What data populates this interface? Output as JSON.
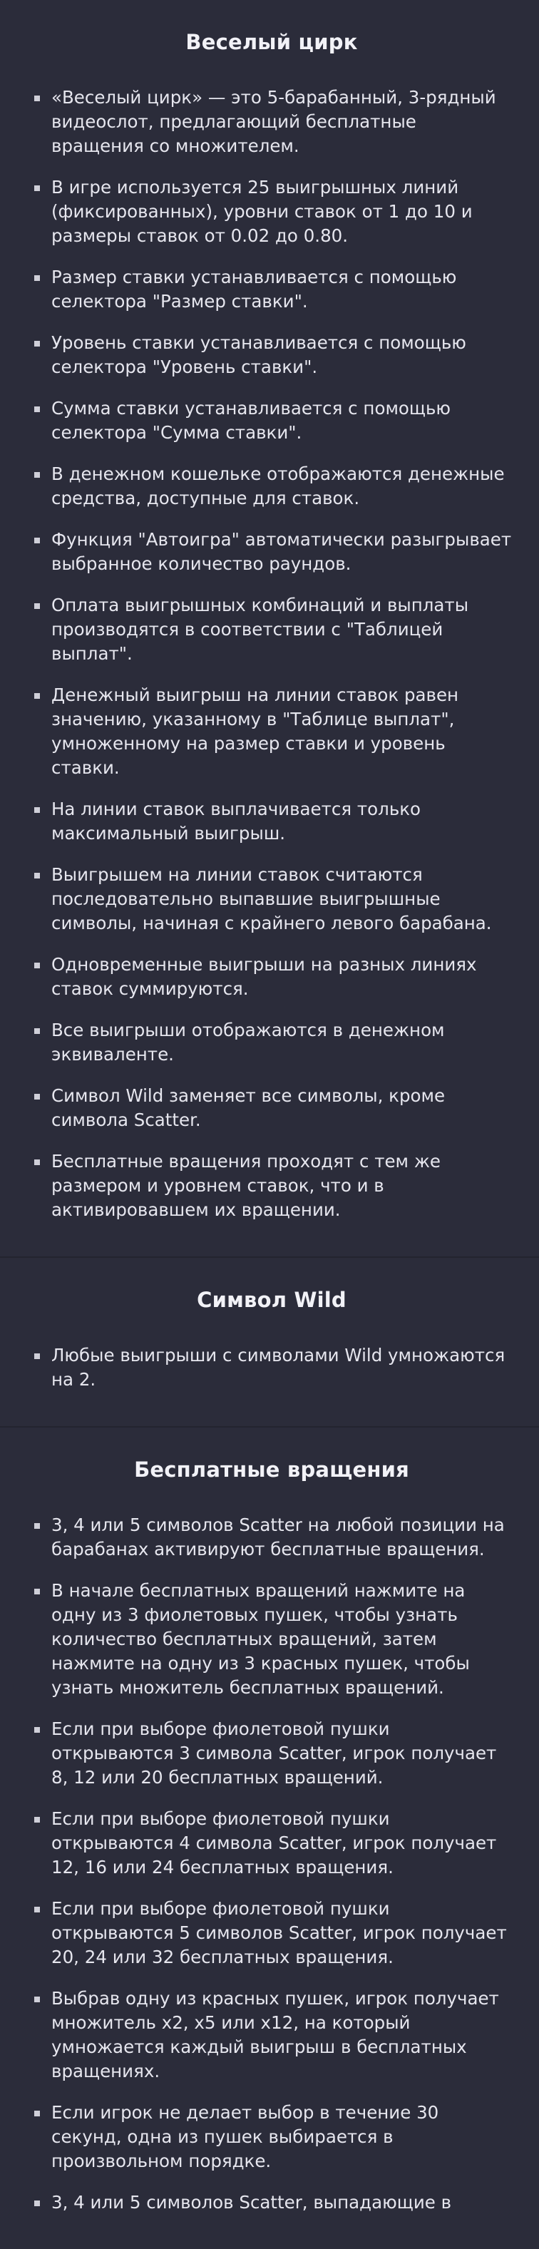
{
  "sections": [
    {
      "title": "Веселый цирк",
      "items": [
        "«Веселый цирк» — это 5-барабанный, 3-рядный видеослот, предлагающий бесплатные вращения со множителем.",
        "В игре используется 25 выигрышных линий (фиксированных), уровни ставок от 1 до 10 и размеры ставок от 0.02 до 0.80.",
        "Размер ставки устанавливается с помощью селектора \"Размер ставки\".",
        "Уровень ставки устанавливается с помощью селектора \"Уровень ставки\".",
        "Сумма ставки устанавливается с помощью селектора \"Сумма ставки\".",
        "В денежном кошельке отображаются денежные средства, доступные для ставок.",
        "Функция \"Автоигра\" автоматически разыгрывает выбранное количество раундов.",
        "Оплата выигрышных комбинаций и выплаты производятся в соответствии с \"Таблицей выплат\".",
        "Денежный выигрыш на линии ставок равен значению, указанному в \"Таблице выплат\", умноженному на размер ставки и уровень ставки.",
        "На линии ставок выплачивается только максимальный выигрыш.",
        "Выигрышем на линии ставок считаются последовательно выпавшие выигрышные символы, начиная с крайнего левого барабана.",
        "Одновременные выигрыши на разных линиях ставок суммируются.",
        "Все выигрыши отображаются в денежном эквиваленте.",
        "Символ Wild заменяет все символы, кроме символа Scatter.",
        "Бесплатные вращения проходят с тем же размером и уровнем ставок, что и в активировавшем их вращении."
      ]
    },
    {
      "title": "Символ Wild",
      "items": [
        "Любые выигрыши с символами Wild умножаются на 2."
      ]
    },
    {
      "title": "Бесплатные вращения",
      "items": [
        "3, 4 или 5 символов Scatter на любой позиции на барабанах активируют бесплатные вращения.",
        "В начале бесплатных вращений нажмите на одну из 3 фиолетовых пушек, чтобы узнать количество бесплатных вращений, затем нажмите на одну из 3 красных пушек, чтобы узнать множитель бесплатных вращений.",
        "Если при выборе фиолетовой пушки открываются 3 символа Scatter, игрок получает 8, 12 или 20 бесплатных вращений.",
        "Если при выборе фиолетовой пушки открываются 4 символа Scatter, игрок получает 12, 16 или 24 бесплатных вращения.",
        "Если при выборе фиолетовой пушки открываются 5 символов Scatter, игрок получает 20, 24 или 32 бесплатных вращения.",
        "Выбрав одну из красных пушек, игрок получает множитель x2, x5 или x12, на который умножается каждый выигрыш в бесплатных вращениях.",
        "Если игрок не делает выбор в течение 30 секунд, одна из пушек выбирается в произвольном порядке.",
        "3, 4 или 5 символов Scatter, выпадающие в"
      ]
    }
  ]
}
